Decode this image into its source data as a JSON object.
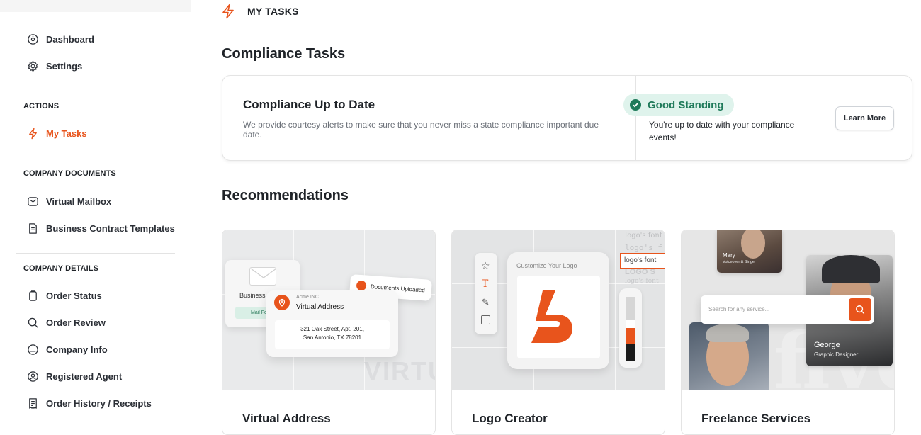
{
  "sidebar": {
    "items_top": [
      {
        "label": "Dashboard",
        "icon": "dashboard-icon"
      },
      {
        "label": "Settings",
        "icon": "gear-icon"
      }
    ],
    "actions_heading": "ACTIONS",
    "actions": [
      {
        "label": "My Tasks",
        "icon": "lightning-icon",
        "active": true
      }
    ],
    "documents_heading": "COMPANY DOCUMENTS",
    "documents": [
      {
        "label": "Virtual Mailbox",
        "icon": "mailbox-icon"
      },
      {
        "label": "Business Contract Templates",
        "icon": "contract-icon"
      }
    ],
    "details_heading": "COMPANY DETAILS",
    "details": [
      {
        "label": "Order Status",
        "icon": "clipboard-icon"
      },
      {
        "label": "Order Review",
        "icon": "search-icon"
      },
      {
        "label": "Company Info",
        "icon": "info-icon"
      },
      {
        "label": "Registered Agent",
        "icon": "agent-icon"
      },
      {
        "label": "Order History / Receipts",
        "icon": "receipt-icon"
      }
    ]
  },
  "header": {
    "title": "MY TASKS"
  },
  "compliance": {
    "section_title": "Compliance Tasks",
    "card_title": "Compliance Up to Date",
    "description": "We provide courtesy alerts to make sure that you never miss a state compliance important due date.",
    "badge": "Good Standing",
    "status": "You're up to date with your compliance events!",
    "button": "Learn More"
  },
  "recommendations": {
    "section_title": "Recommendations",
    "cards": [
      {
        "title": "Virtual Address",
        "mock": {
          "business": "Business",
          "mail_forwarding": "Mail Forw",
          "company": "Acme INC.",
          "card_label": "Virtual Address",
          "docs": "Documents Uploaded",
          "address_line1": "321 Oak Street, Apt. 201,",
          "address_line2": "San Antonio, TX 78201",
          "watermark": "VIRTUZEE"
        }
      },
      {
        "title": "Logo Creator",
        "mock": {
          "customize": "Customize Your Logo",
          "font1": "logo's font",
          "font2": "logo's f",
          "font_input": "logo's font",
          "font3": "LOGO S",
          "font4": "logo's font"
        }
      },
      {
        "title": "Freelance Services",
        "mock": {
          "search_placeholder": "Search for any service...",
          "person1_name": "Mary",
          "person1_role": "Voiceover & Singer",
          "person2_name": "George",
          "person2_role": "Graphic Designer"
        }
      }
    ]
  },
  "colors": {
    "accent": "#e8541c",
    "success": "#1f7a5a",
    "success_bg": "#dff3ec"
  }
}
